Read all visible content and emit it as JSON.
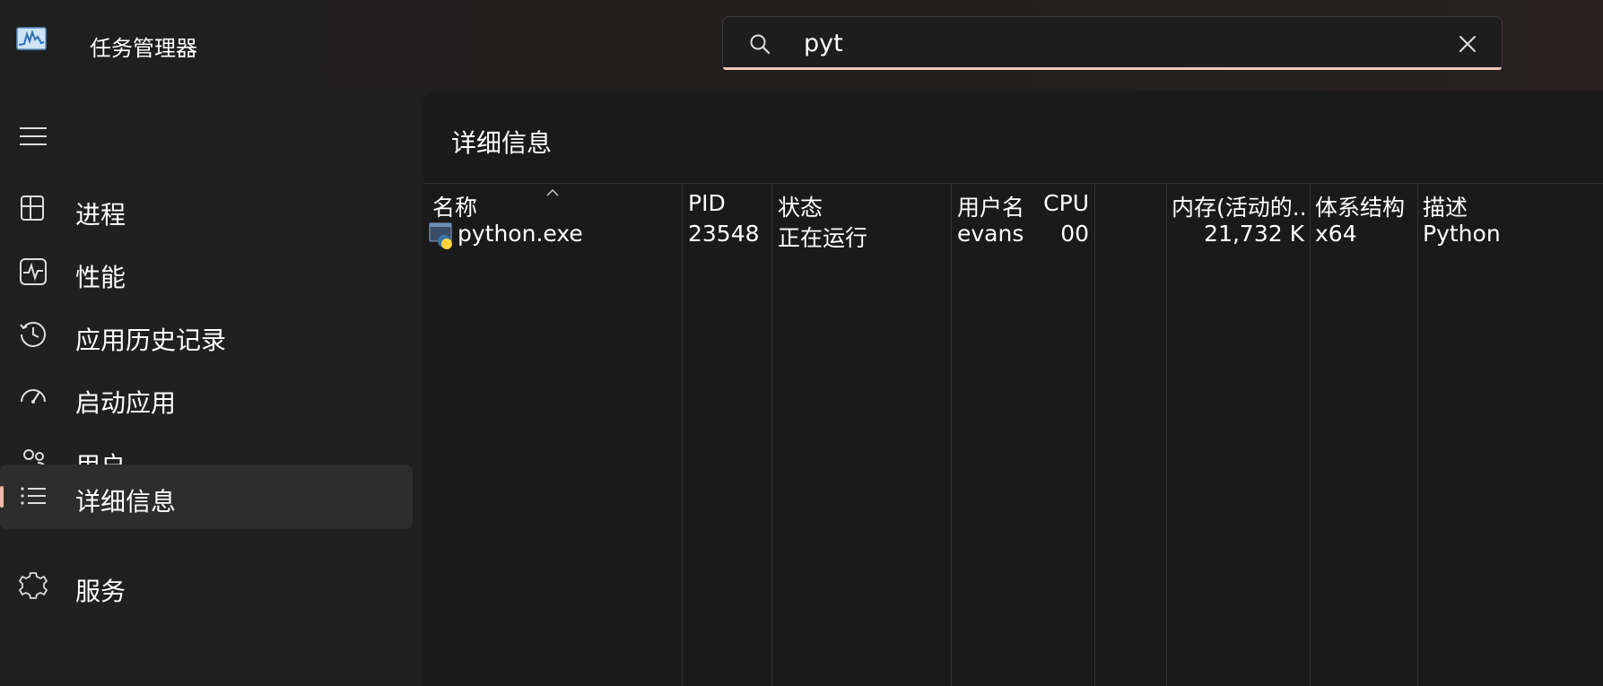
{
  "app": {
    "title": "任务管理器",
    "icon": "task-manager-icon"
  },
  "search": {
    "value": "pyt",
    "placeholder": ""
  },
  "sidebar": {
    "items": [
      {
        "label": "进程",
        "icon": "processes-icon"
      },
      {
        "label": "性能",
        "icon": "performance-icon"
      },
      {
        "label": "应用历史记录",
        "icon": "app-history-icon"
      },
      {
        "label": "启动应用",
        "icon": "startup-apps-icon"
      },
      {
        "label": "用户",
        "icon": "users-icon"
      },
      {
        "label": "详细信息",
        "icon": "details-icon",
        "active": true
      },
      {
        "label": "服务",
        "icon": "services-icon"
      }
    ]
  },
  "main": {
    "title": "详细信息",
    "table": {
      "columns": [
        "名称",
        "PID",
        "状态",
        "用户名",
        "CPU",
        "内存(活动的...",
        "体系结构",
        "描述"
      ],
      "sorted_column": "名称",
      "rows": [
        {
          "name": "python.exe",
          "pid": "23548",
          "status": "正在运行",
          "user": "evans",
          "cpu": "00",
          "memory": "21,732 K",
          "arch": "x64",
          "desc": "Python"
        }
      ]
    }
  },
  "colors": {
    "accent": "#f0b8a8",
    "bg": "#202020",
    "panel": "#1a1a1a",
    "active_nav": "#2d2d2d"
  }
}
